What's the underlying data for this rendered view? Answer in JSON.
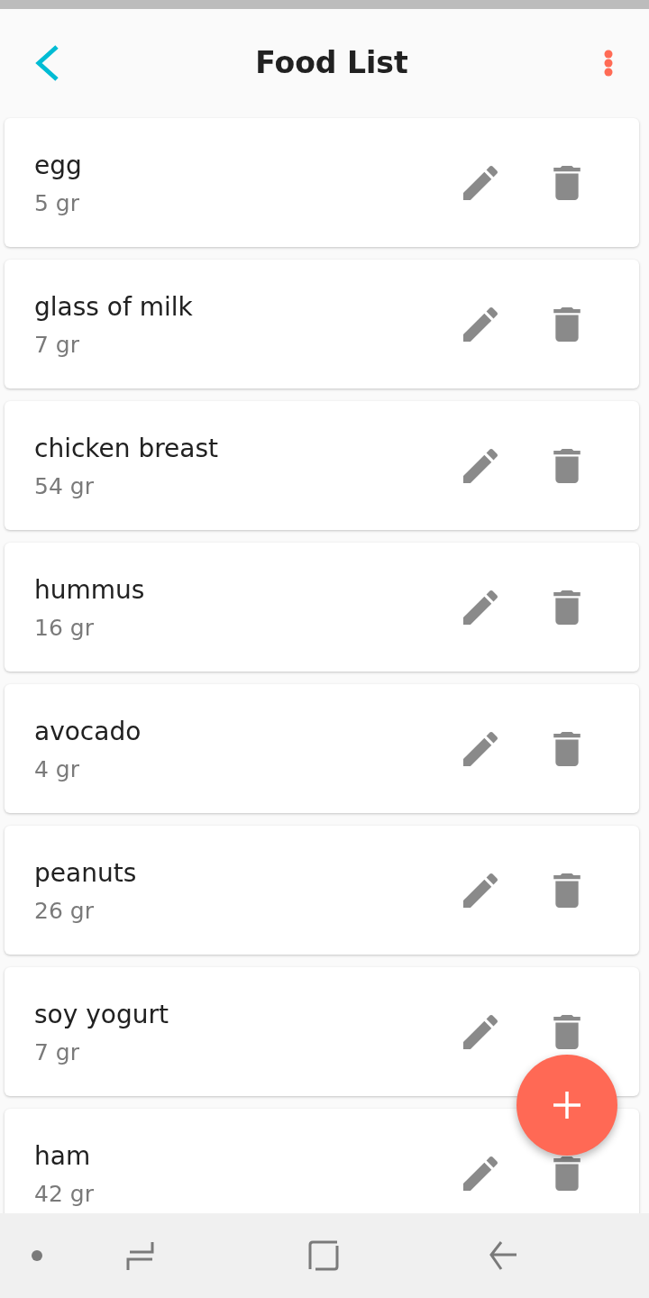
{
  "header": {
    "title": "Food List"
  },
  "foods": [
    {
      "name": "egg",
      "weight": "5 gr"
    },
    {
      "name": "glass of milk",
      "weight": "7 gr"
    },
    {
      "name": "chicken breast",
      "weight": "54 gr"
    },
    {
      "name": "hummus",
      "weight": "16 gr"
    },
    {
      "name": "avocado",
      "weight": "4 gr"
    },
    {
      "name": "peanuts",
      "weight": "26 gr"
    },
    {
      "name": "soy yogurt",
      "weight": "7 gr"
    },
    {
      "name": "ham",
      "weight": "42 gr"
    }
  ]
}
